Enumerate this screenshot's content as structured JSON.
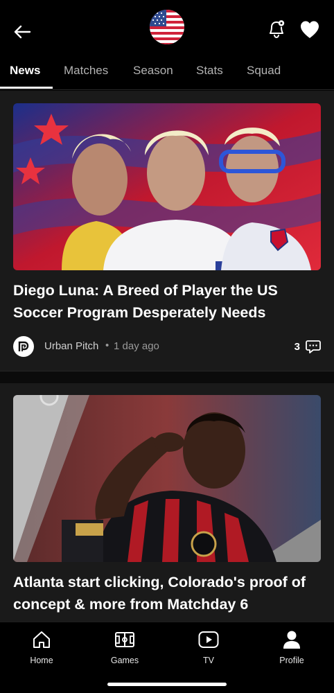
{
  "header": {
    "back_icon": "arrow-left-icon",
    "team_flag": "usa-flag",
    "bell_icon": "bell-settings-icon",
    "heart_icon": "heart-icon"
  },
  "tabs": [
    {
      "label": "News",
      "active": true
    },
    {
      "label": "Matches",
      "active": false
    },
    {
      "label": "Season",
      "active": false
    },
    {
      "label": "Stats",
      "active": false
    },
    {
      "label": "Squad",
      "active": false
    }
  ],
  "articles": [
    {
      "title": "Diego Luna: A Breed of Player the US Soccer Program Desperately Needs",
      "source": "Urban Pitch",
      "time": "1 day ago",
      "comments": "3"
    },
    {
      "title": "Atlanta start clicking, Colorado's proof of concept & more from Matchday 6"
    }
  ],
  "bottom_nav": [
    {
      "label": "Home",
      "icon": "home-icon"
    },
    {
      "label": "Games",
      "icon": "pitch-icon"
    },
    {
      "label": "TV",
      "icon": "play-icon"
    },
    {
      "label": "Profile",
      "icon": "person-icon"
    }
  ],
  "colors": {
    "background": "#000000",
    "feed_background": "#1a1a1a",
    "text_primary": "#ffffff",
    "text_secondary": "#9a9a9a"
  }
}
